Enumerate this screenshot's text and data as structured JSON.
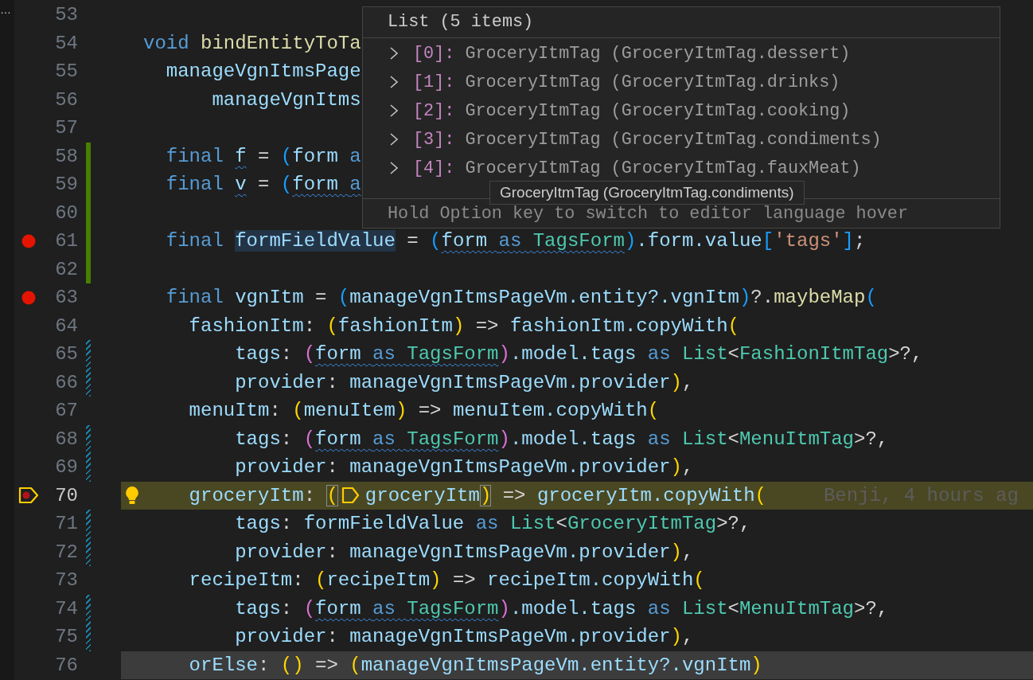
{
  "side_strip": {
    "text": "…"
  },
  "lines": [
    {
      "number": "53"
    },
    {
      "number": "54",
      "tokens": [
        {
          "text": "void ",
          "kind": "keyword"
        },
        {
          "text": "bindEntityToTa",
          "kind": "function"
        }
      ]
    },
    {
      "number": "55",
      "tokens": [
        {
          "text": "  manageVgnItmsPage",
          "kind": "variable"
        }
      ]
    },
    {
      "number": "56",
      "tokens": [
        {
          "text": "      manageVgnItms",
          "kind": "variable"
        }
      ]
    },
    {
      "number": "57"
    },
    {
      "number": "58",
      "added": true,
      "tokens": [
        {
          "text": "  final ",
          "kind": "keyword"
        },
        {
          "text": "f",
          "kind": "variable",
          "squiggle": true
        },
        {
          "text": " = ",
          "kind": "punct"
        },
        {
          "text": "(",
          "kind": "bracket-blue"
        },
        {
          "text": "form ",
          "kind": "variable"
        },
        {
          "text": "a",
          "kind": "keyword"
        }
      ]
    },
    {
      "number": "59",
      "added": true,
      "tokens": [
        {
          "text": "  final ",
          "kind": "keyword"
        },
        {
          "text": "v",
          "kind": "variable",
          "squiggle": true
        },
        {
          "text": " = ",
          "kind": "punct"
        },
        {
          "text": "(",
          "kind": "bracket-blue"
        },
        {
          "text": "form ",
          "kind": "variable",
          "squiggle": true
        },
        {
          "text": "a",
          "kind": "keyword",
          "squiggle": true
        }
      ]
    },
    {
      "number": "60",
      "added": true
    },
    {
      "number": "61",
      "breakpoint": true,
      "added": true,
      "tokens": [
        {
          "text": "  final ",
          "kind": "keyword"
        },
        {
          "text": "formFieldValue",
          "kind": "variable",
          "highlight": true
        },
        {
          "text": " = ",
          "kind": "punct"
        },
        {
          "text": "(",
          "kind": "bracket-blue"
        },
        {
          "text": "form ",
          "kind": "variable",
          "squiggle": true
        },
        {
          "text": "as ",
          "kind": "keyword",
          "squiggle": true
        },
        {
          "text": "TagsForm",
          "kind": "type",
          "squiggle": true
        },
        {
          "text": ")",
          "kind": "bracket-blue"
        },
        {
          "text": ".form.value",
          "kind": "variable"
        },
        {
          "text": "[",
          "kind": "bracket-blue"
        },
        {
          "text": "'tags'",
          "kind": "string"
        },
        {
          "text": "]",
          "kind": "bracket-blue"
        },
        {
          "text": ";",
          "kind": "punct"
        }
      ]
    },
    {
      "number": "62",
      "added": true
    },
    {
      "number": "63",
      "breakpoint": true,
      "tokens": [
        {
          "text": "  final ",
          "kind": "keyword"
        },
        {
          "text": "vgnItm",
          "kind": "variable"
        },
        {
          "text": " = ",
          "kind": "punct"
        },
        {
          "text": "(",
          "kind": "bracket-blue"
        },
        {
          "text": "manageVgnItmsPageVm.entity?.vgnItm",
          "kind": "variable"
        },
        {
          "text": ")",
          "kind": "bracket-blue"
        },
        {
          "text": "?.",
          "kind": "punct"
        },
        {
          "text": "maybeMap",
          "kind": "function"
        },
        {
          "text": "(",
          "kind": "bracket-blue"
        }
      ]
    },
    {
      "number": "64",
      "tokens": [
        {
          "text": "    fashionItm",
          "kind": "variable"
        },
        {
          "text": ": ",
          "kind": "punct"
        },
        {
          "text": "(",
          "kind": "bracket-gold"
        },
        {
          "text": "fashionItm",
          "kind": "variable"
        },
        {
          "text": ")",
          "kind": "bracket-gold"
        },
        {
          "text": " => ",
          "kind": "punct"
        },
        {
          "text": "fashionItm.copyWith",
          "kind": "variable"
        },
        {
          "text": "(",
          "kind": "bracket-gold"
        }
      ]
    },
    {
      "number": "65",
      "modified": true,
      "tokens": [
        {
          "text": "        tags",
          "kind": "variable"
        },
        {
          "text": ": ",
          "kind": "punct"
        },
        {
          "text": "(",
          "kind": "bracket-orchid"
        },
        {
          "text": "form ",
          "kind": "variable",
          "squiggle": true
        },
        {
          "text": "as ",
          "kind": "keyword",
          "squiggle": true
        },
        {
          "text": "TagsForm",
          "kind": "type",
          "squiggle": true
        },
        {
          "text": ")",
          "kind": "bracket-orchid"
        },
        {
          "text": ".model.tags ",
          "kind": "variable"
        },
        {
          "text": "as ",
          "kind": "keyword"
        },
        {
          "text": "List",
          "kind": "type"
        },
        {
          "text": "<",
          "kind": "punct"
        },
        {
          "text": "FashionItmTag",
          "kind": "type"
        },
        {
          "text": ">?,",
          "kind": "punct"
        }
      ]
    },
    {
      "number": "66",
      "modified": true,
      "tokens": [
        {
          "text": "        provider",
          "kind": "variable"
        },
        {
          "text": ": ",
          "kind": "punct"
        },
        {
          "text": "manageVgnItmsPageVm.provider",
          "kind": "variable"
        },
        {
          "text": ")",
          "kind": "bracket-gold"
        },
        {
          "text": ",",
          "kind": "punct"
        }
      ]
    },
    {
      "number": "67",
      "tokens": [
        {
          "text": "    menuItm",
          "kind": "variable"
        },
        {
          "text": ": ",
          "kind": "punct"
        },
        {
          "text": "(",
          "kind": "bracket-gold"
        },
        {
          "text": "menuItem",
          "kind": "variable"
        },
        {
          "text": ")",
          "kind": "bracket-gold"
        },
        {
          "text": " => ",
          "kind": "punct"
        },
        {
          "text": "menuItem.copyWith",
          "kind": "variable"
        },
        {
          "text": "(",
          "kind": "bracket-gold"
        }
      ]
    },
    {
      "number": "68",
      "modified": true,
      "tokens": [
        {
          "text": "        tags",
          "kind": "variable"
        },
        {
          "text": ": ",
          "kind": "punct"
        },
        {
          "text": "(",
          "kind": "bracket-orchid"
        },
        {
          "text": "form ",
          "kind": "variable",
          "squiggle": true
        },
        {
          "text": "as ",
          "kind": "keyword",
          "squiggle": true
        },
        {
          "text": "TagsForm",
          "kind": "type",
          "squiggle": true
        },
        {
          "text": ")",
          "kind": "bracket-orchid"
        },
        {
          "text": ".model.tags ",
          "kind": "variable"
        },
        {
          "text": "as ",
          "kind": "keyword"
        },
        {
          "text": "List",
          "kind": "type"
        },
        {
          "text": "<",
          "kind": "punct"
        },
        {
          "text": "MenuItmTag",
          "kind": "type"
        },
        {
          "text": ">?,",
          "kind": "punct"
        }
      ]
    },
    {
      "number": "69",
      "modified": true,
      "tokens": [
        {
          "text": "        provider",
          "kind": "variable"
        },
        {
          "text": ": ",
          "kind": "punct"
        },
        {
          "text": "manageVgnItmsPageVm.provider",
          "kind": "variable"
        },
        {
          "text": ")",
          "kind": "bracket-gold"
        },
        {
          "text": ",",
          "kind": "punct"
        }
      ]
    },
    {
      "number": "70",
      "paused": true,
      "lightbulb": true,
      "blame": "Benji, 4 hours ag",
      "tokens": [
        {
          "text": "    groceryItm",
          "kind": "variable"
        },
        {
          "text": ": ",
          "kind": "punct"
        },
        {
          "text": "(",
          "kind": "bracket-gold",
          "matched": true
        },
        {
          "text": "groceryItm",
          "kind": "variable",
          "paused": true
        },
        {
          "text": ")",
          "kind": "bracket-gold",
          "matched": true
        },
        {
          "text": " => ",
          "kind": "punct"
        },
        {
          "text": "groceryItm.copyWith",
          "kind": "variable"
        },
        {
          "text": "(",
          "kind": "bracket-gold"
        }
      ]
    },
    {
      "number": "71",
      "modified": true,
      "tokens": [
        {
          "text": "        tags",
          "kind": "variable"
        },
        {
          "text": ": ",
          "kind": "punct"
        },
        {
          "text": "formFieldValue ",
          "kind": "variable"
        },
        {
          "text": "as ",
          "kind": "keyword"
        },
        {
          "text": "List",
          "kind": "type"
        },
        {
          "text": "<",
          "kind": "punct"
        },
        {
          "text": "GroceryItmTag",
          "kind": "type"
        },
        {
          "text": ">?,",
          "kind": "punct"
        }
      ]
    },
    {
      "number": "72",
      "modified": true,
      "tokens": [
        {
          "text": "        provider",
          "kind": "variable"
        },
        {
          "text": ": ",
          "kind": "punct"
        },
        {
          "text": "manageVgnItmsPageVm.provider",
          "kind": "variable"
        },
        {
          "text": ")",
          "kind": "bracket-gold"
        },
        {
          "text": ",",
          "kind": "punct"
        }
      ]
    },
    {
      "number": "73",
      "tokens": [
        {
          "text": "    recipeItm",
          "kind": "variable"
        },
        {
          "text": ": ",
          "kind": "punct"
        },
        {
          "text": "(",
          "kind": "bracket-gold"
        },
        {
          "text": "recipeItm",
          "kind": "variable"
        },
        {
          "text": ")",
          "kind": "bracket-gold"
        },
        {
          "text": " => ",
          "kind": "punct"
        },
        {
          "text": "recipeItm.copyWith",
          "kind": "variable"
        },
        {
          "text": "(",
          "kind": "bracket-gold"
        }
      ]
    },
    {
      "number": "74",
      "modified": true,
      "tokens": [
        {
          "text": "        tags",
          "kind": "variable"
        },
        {
          "text": ": ",
          "kind": "punct"
        },
        {
          "text": "(",
          "kind": "bracket-orchid"
        },
        {
          "text": "form ",
          "kind": "variable",
          "squiggle": true
        },
        {
          "text": "as ",
          "kind": "keyword",
          "squiggle": true
        },
        {
          "text": "TagsForm",
          "kind": "type",
          "squiggle": true
        },
        {
          "text": ")",
          "kind": "bracket-orchid"
        },
        {
          "text": ".model.tags ",
          "kind": "variable"
        },
        {
          "text": "as ",
          "kind": "keyword"
        },
        {
          "text": "List",
          "kind": "type"
        },
        {
          "text": "<",
          "kind": "punct"
        },
        {
          "text": "MenuItmTag",
          "kind": "type"
        },
        {
          "text": ">?,",
          "kind": "punct"
        }
      ]
    },
    {
      "number": "75",
      "modified": true,
      "tokens": [
        {
          "text": "        provider",
          "kind": "variable"
        },
        {
          "text": ": ",
          "kind": "punct"
        },
        {
          "text": "manageVgnItmsPageVm.provider",
          "kind": "variable"
        },
        {
          "text": ")",
          "kind": "bracket-gold"
        },
        {
          "text": ",",
          "kind": "punct"
        }
      ]
    },
    {
      "number": "76",
      "shaded": true,
      "tokens": [
        {
          "text": "    orElse",
          "kind": "variable"
        },
        {
          "text": ": ",
          "kind": "punct"
        },
        {
          "text": "()",
          "kind": "bracket-gold"
        },
        {
          "text": " => ",
          "kind": "punct"
        },
        {
          "text": "(",
          "kind": "bracket-gold"
        },
        {
          "text": "manageVgnItmsPageVm.entity?.vgnItm",
          "kind": "variable"
        },
        {
          "text": ")",
          "kind": "bracket-gold"
        }
      ]
    }
  ],
  "hover": {
    "title": "List (5 items)",
    "items": [
      {
        "label": "[0]:",
        "value": "GroceryItmTag (GroceryItmTag.dessert)",
        "expanded": false
      },
      {
        "label": "[1]:",
        "value": "GroceryItmTag (GroceryItmTag.drinks)",
        "expanded": false
      },
      {
        "label": "[2]:",
        "value": "GroceryItmTag (GroceryItmTag.cooking)",
        "expanded": false
      },
      {
        "label": "[3]:",
        "value": "GroceryItmTag (GroceryItmTag.condiments)",
        "expanded": false
      },
      {
        "label": "[4]:",
        "value": "GroceryItmTag (GroceryItmTag.fauxMeat)",
        "expanded": false
      }
    ],
    "tooltip": "GroceryItmTag (GroceryItmTag.condiments)",
    "footer": "Hold Option key to switch to editor language hover"
  }
}
